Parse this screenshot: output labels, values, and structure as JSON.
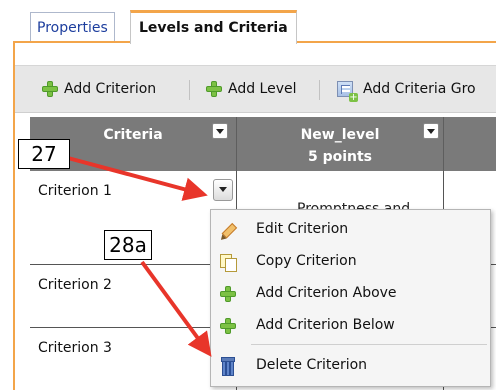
{
  "tabs": [
    {
      "label": "Properties",
      "active": false
    },
    {
      "label": "Levels and Criteria",
      "active": true
    }
  ],
  "toolbar": {
    "add_criterion_label": "Add Criterion",
    "add_level_label": "Add Level",
    "add_criteria_group_label": "Add Criteria Gro"
  },
  "table": {
    "headers": [
      {
        "line1": "Criteria",
        "line2": ""
      },
      {
        "line1": "New_level",
        "line2": "5 points"
      }
    ],
    "rows": [
      {
        "criterion": "Criterion 1",
        "level_text": "Promptness and"
      },
      {
        "criterion": "Criterion 2",
        "level_text": ""
      },
      {
        "criterion": "Criterion 3",
        "level_text": ""
      }
    ]
  },
  "context_menu": {
    "items": [
      {
        "label": "Edit Criterion",
        "icon": "pencil-icon"
      },
      {
        "label": "Copy Criterion",
        "icon": "copy-icon"
      },
      {
        "label": "Add Criterion Above",
        "icon": "plus-icon"
      },
      {
        "label": "Add Criterion Below",
        "icon": "plus-icon"
      },
      {
        "label": "Delete Criterion",
        "icon": "trash-icon"
      }
    ]
  },
  "annotations": {
    "callout_1": "27",
    "callout_2": "28a"
  },
  "colors": {
    "tab_accent": "#f3a54a",
    "header_bg": "#7a7a7a",
    "arrow": "#e8352a",
    "plus_green": "#7cc144"
  }
}
